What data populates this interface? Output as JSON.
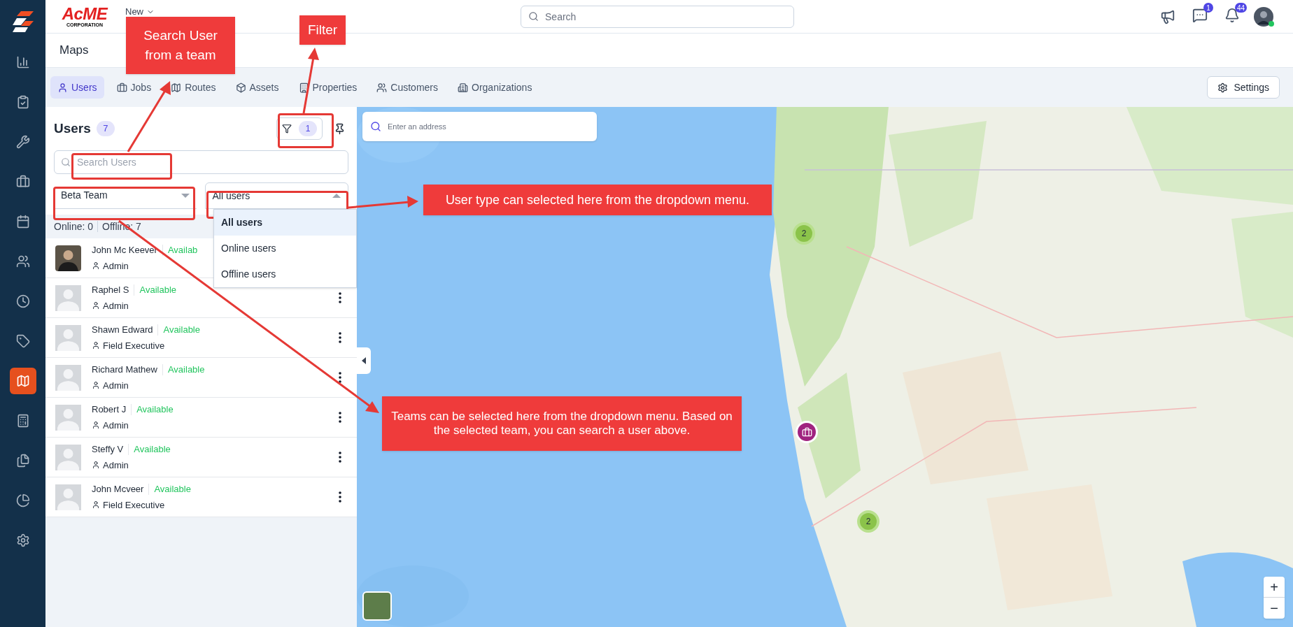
{
  "logo": {
    "name": "AcME",
    "tagline": "CORPORATION"
  },
  "header": {
    "new_menu": "New",
    "search_placeholder": "Search",
    "chat_badge": "1",
    "notifications_badge": "44"
  },
  "sidebar": {
    "items": [
      {
        "kind": "chart",
        "selected": false
      },
      {
        "kind": "tasks",
        "selected": false
      },
      {
        "kind": "tools",
        "selected": false
      },
      {
        "kind": "briefcase",
        "selected": false
      },
      {
        "kind": "calendar",
        "selected": false
      },
      {
        "kind": "people",
        "selected": false
      },
      {
        "kind": "clock",
        "selected": false
      },
      {
        "kind": "tag",
        "selected": false
      },
      {
        "kind": "map",
        "selected": true
      },
      {
        "kind": "calculator",
        "selected": false
      },
      {
        "kind": "files",
        "selected": false
      },
      {
        "kind": "pie",
        "selected": false
      },
      {
        "kind": "settings",
        "selected": false
      }
    ]
  },
  "page_title": "Maps",
  "tabs": [
    {
      "label": "Users",
      "kind": "user",
      "selected": true
    },
    {
      "label": "Jobs",
      "kind": "briefcase",
      "selected": false
    },
    {
      "label": "Routes",
      "kind": "map",
      "selected": false
    },
    {
      "label": "Assets",
      "kind": "box",
      "selected": false
    },
    {
      "label": "Properties",
      "kind": "building",
      "selected": false
    },
    {
      "label": "Customers",
      "kind": "people",
      "selected": false
    },
    {
      "label": "Organizations",
      "kind": "org",
      "selected": false
    }
  ],
  "settings_button": "Settings",
  "users_panel": {
    "title": "Users",
    "count": "7",
    "filter_count": "1",
    "search_placeholder": "Search Users",
    "team_dropdown": {
      "value": "Beta Team",
      "expanded": false
    },
    "type_dropdown": {
      "value": "All users",
      "expanded": true,
      "options": [
        {
          "label": "All users",
          "selected": true
        },
        {
          "label": "Online users",
          "selected": false
        },
        {
          "label": "Offline users",
          "selected": false
        }
      ]
    },
    "online": "Online: 0",
    "offline": "Offline: 7",
    "users": [
      {
        "name": "John Mc Keever",
        "status": "Availab",
        "role": "Admin",
        "has_photo": true
      },
      {
        "name": "Raphel S",
        "status": "Available",
        "role": "Admin",
        "has_photo": false
      },
      {
        "name": "Shawn Edward",
        "status": "Available",
        "role": "Field Executive",
        "has_photo": false
      },
      {
        "name": "Richard Mathew",
        "status": "Available",
        "role": "Admin",
        "has_photo": false
      },
      {
        "name": "Robert J",
        "status": "Available",
        "role": "Admin",
        "has_photo": false
      },
      {
        "name": "Steffy V",
        "status": "Available",
        "role": "Admin",
        "has_photo": false
      },
      {
        "name": "John Mcveer",
        "status": "Available",
        "role": "Field Executive",
        "has_photo": false
      }
    ]
  },
  "map": {
    "address_placeholder": "Enter an address",
    "markers": [
      {
        "kind": "cluster",
        "count": "2"
      },
      {
        "kind": "job"
      },
      {
        "kind": "cluster",
        "count": "2"
      }
    ],
    "zoom_in": "+",
    "zoom_out": "−"
  },
  "annotations": [
    {
      "text": "Search User from a team"
    },
    {
      "text": "Filter"
    },
    {
      "text": "User type can selected here from the dropdown menu."
    },
    {
      "text": "Teams can be selected here from the dropdown menu. Based on the selected team, you can search a user above."
    }
  ]
}
